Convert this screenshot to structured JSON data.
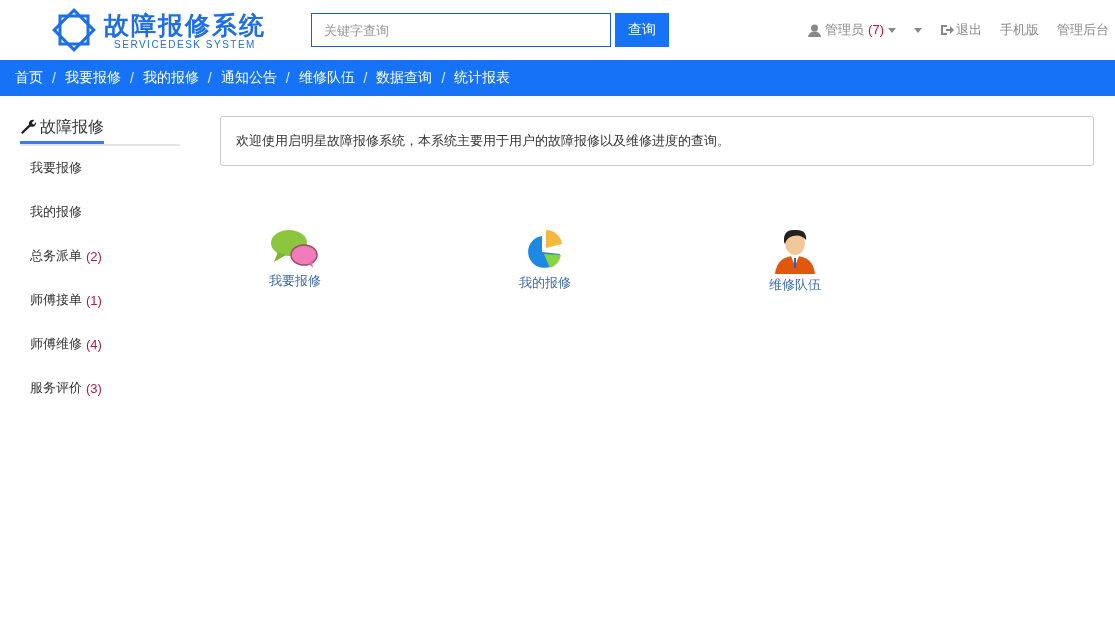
{
  "logo": {
    "title": "故障报修系统",
    "subtitle": "SERVICEDESK SYSTEM"
  },
  "search": {
    "placeholder": "关键字查询",
    "button": "查询"
  },
  "user_menu": {
    "name": "管理员",
    "count": "(7)"
  },
  "top_links": [
    {
      "label": "退出",
      "kind": "logout"
    },
    {
      "label": "手机版",
      "kind": "plain"
    },
    {
      "label": "管理后台",
      "kind": "plain"
    }
  ],
  "nav": [
    "首页",
    "我要报修",
    "我的报修",
    "通知公告",
    "维修队伍",
    "数据查询",
    "统计报表"
  ],
  "nav_separator": "/",
  "sidebar": {
    "title": "故障报修",
    "items": [
      {
        "label": "我要报修"
      },
      {
        "label": "我的报修"
      },
      {
        "label": "总务派单",
        "count": "(2)"
      },
      {
        "label": "师傅接单",
        "count": "(1)"
      },
      {
        "label": "师傅维修",
        "count": "(4)"
      },
      {
        "label": "服务评价",
        "count": "(3)"
      }
    ]
  },
  "notice": "欢迎使用启明星故障报修系统，本系统主要用于用户的故障报修以及维修进度的查询。",
  "tiles": [
    {
      "label": "我要报修",
      "kind": "chat"
    },
    {
      "label": "我的报修",
      "kind": "pie"
    },
    {
      "label": "维修队伍",
      "kind": "person"
    }
  ]
}
